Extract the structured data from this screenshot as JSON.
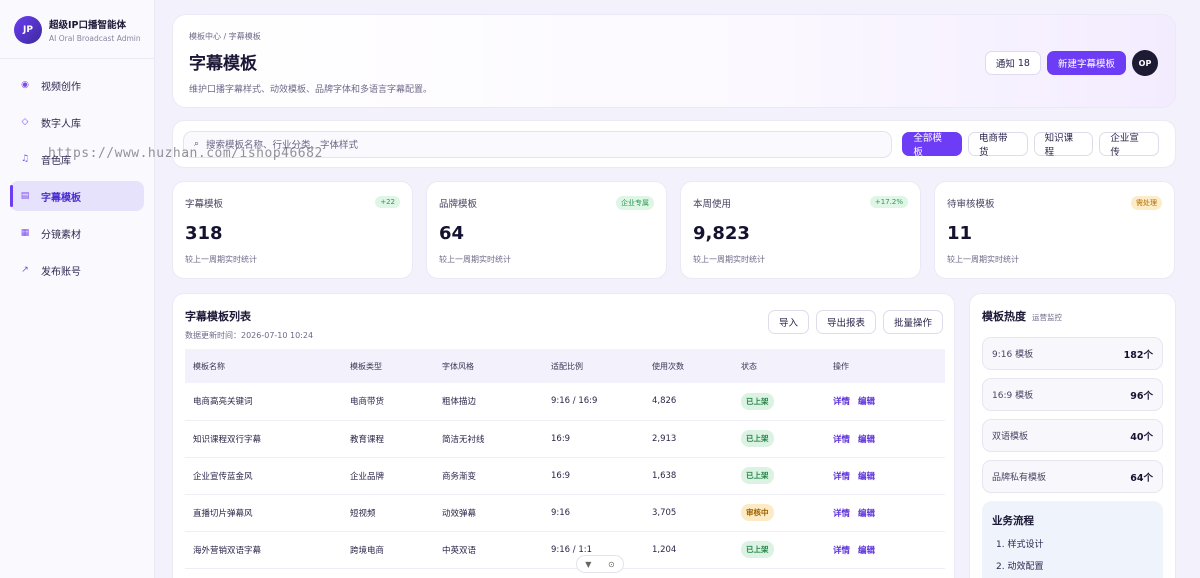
{
  "brand": {
    "logo": "JP",
    "title": "超级IP口播智能体",
    "subtitle": "AI Oral Broadcast Admin"
  },
  "sidebar": {
    "items": [
      {
        "label": "视频创作",
        "icon": "record-icon"
      },
      {
        "label": "数字人库",
        "icon": "diamond-icon"
      },
      {
        "label": "音色库",
        "icon": "music-note-icon"
      },
      {
        "label": "字幕模板",
        "icon": "square-icon"
      },
      {
        "label": "分镜素材",
        "icon": "square-icon"
      },
      {
        "label": "发布账号",
        "icon": "arrow-up-right-icon"
      }
    ]
  },
  "watermark": "https://www.huzhan.com/ishop46682",
  "header": {
    "breadcrumb": "模板中心 / 字幕模板",
    "title": "字幕模板",
    "subtitle": "维护口播字幕样式、动效模板、品牌字体和多语言字幕配置。",
    "notify_label": "通知",
    "notify_count": "18",
    "new_button": "新建字幕模板",
    "avatar": "OP"
  },
  "search": {
    "placeholder": "搜索模板名称、行业分类、字体样式"
  },
  "filters": [
    "全部模板",
    "电商带货",
    "知识课程",
    "企业宣传"
  ],
  "stats": [
    {
      "label": "字幕模板",
      "badge": "+22",
      "value": "318",
      "foot": "较上一周期实时统计"
    },
    {
      "label": "品牌模板",
      "badge": "企业专属",
      "value": "64",
      "foot": "较上一周期实时统计"
    },
    {
      "label": "本周使用",
      "badge": "+17.2%",
      "value": "9,823",
      "foot": "较上一周期实时统计"
    },
    {
      "label": "待审核模板",
      "badge": "需处理",
      "value": "11",
      "foot": "较上一周期实时统计"
    }
  ],
  "table": {
    "title": "字幕模板列表",
    "updated": "数据更新时间：2026-07-10 10:24",
    "actions": [
      "导入",
      "导出报表",
      "批量操作"
    ],
    "headers": [
      "模板名称",
      "模板类型",
      "字体风格",
      "适配比例",
      "使用次数",
      "状态",
      "操作"
    ],
    "rows": [
      {
        "name": "电商高亮关键词",
        "type": "电商带货",
        "font": "粗体描边",
        "ratio": "9:16 / 16:9",
        "uses": "4,826",
        "status": "已上架"
      },
      {
        "name": "知识课程双行字幕",
        "type": "教育课程",
        "font": "简洁无衬线",
        "ratio": "16:9",
        "uses": "2,913",
        "status": "已上架"
      },
      {
        "name": "企业宣传蓝金风",
        "type": "企业品牌",
        "font": "商务渐变",
        "ratio": "16:9",
        "uses": "1,638",
        "status": "已上架"
      },
      {
        "name": "直播切片弹幕风",
        "type": "短视频",
        "font": "动效弹幕",
        "ratio": "9:16",
        "uses": "3,705",
        "status": "审核中"
      },
      {
        "name": "海外营销双语字幕",
        "type": "跨境电商",
        "font": "中英双语",
        "ratio": "9:16 / 1:1",
        "uses": "1,204",
        "status": "已上架"
      }
    ],
    "detail_label": "详情",
    "edit_label": "编辑"
  },
  "heat": {
    "title": "模板热度",
    "subtitle": "运营监控",
    "items": [
      {
        "label": "9:16 模板",
        "value": "182个"
      },
      {
        "label": "16:9 模板",
        "value": "96个"
      },
      {
        "label": "双语模板",
        "value": "40个"
      },
      {
        "label": "品牌私有模板",
        "value": "64个"
      }
    ],
    "flow_title": "业务流程",
    "flow_steps": [
      "1. 样式设计",
      "2. 动效配置"
    ]
  },
  "colors": {
    "accent": "#6d3df5",
    "green": "#25874a",
    "orange": "#9e6200"
  }
}
